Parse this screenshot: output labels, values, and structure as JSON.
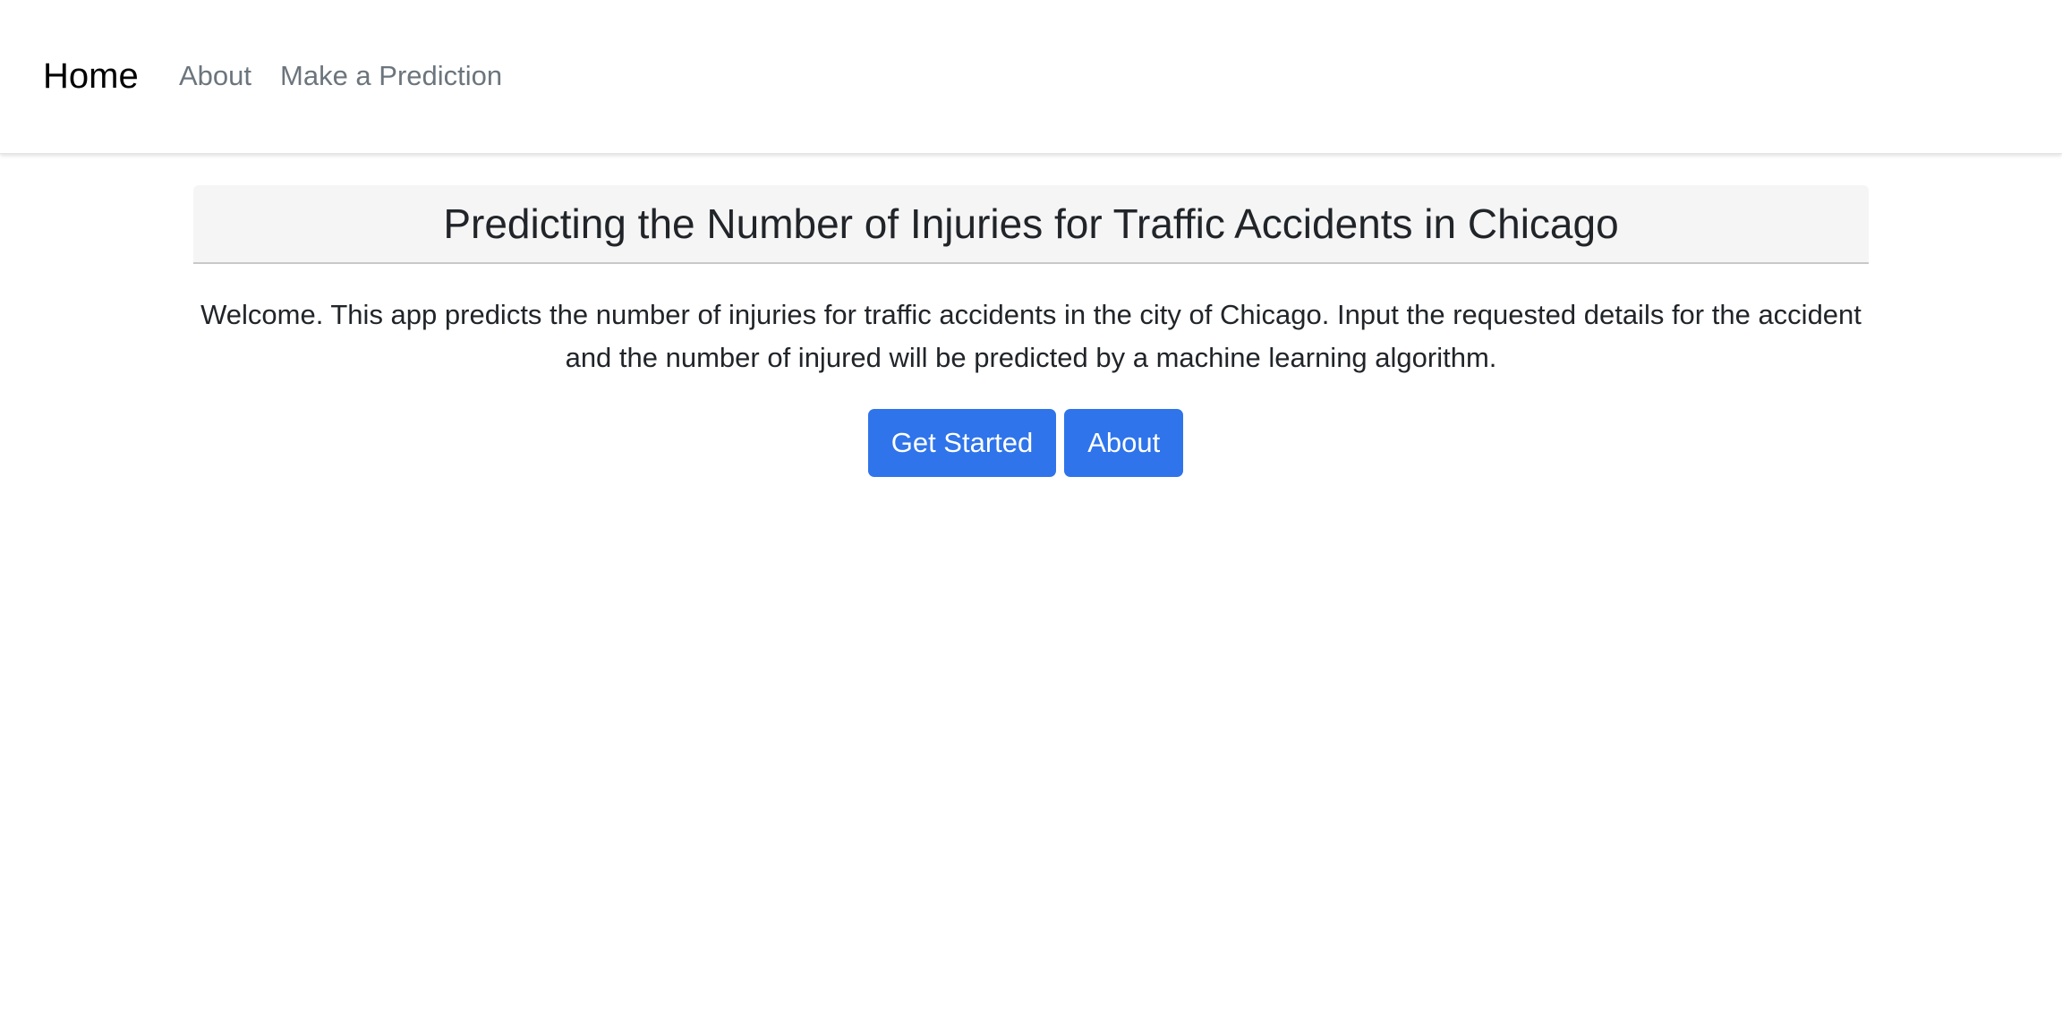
{
  "navbar": {
    "brand": "Home",
    "links": [
      {
        "label": "About"
      },
      {
        "label": "Make a Prediction"
      }
    ]
  },
  "main": {
    "title": "Predicting the Number of Injuries for Traffic Accidents in Chicago",
    "intro": "Welcome. This app predicts the number of injuries for traffic accidents in the city of Chicago. Input the requested details for the accident and the number of injured will be predicted by a machine learning algorithm.",
    "buttons": {
      "get_started": "Get Started",
      "about": "About"
    }
  },
  "colors": {
    "button_bg": "#2f74ea",
    "nav_link": "#6c757d",
    "title_bar_bg": "#f5f5f5"
  }
}
